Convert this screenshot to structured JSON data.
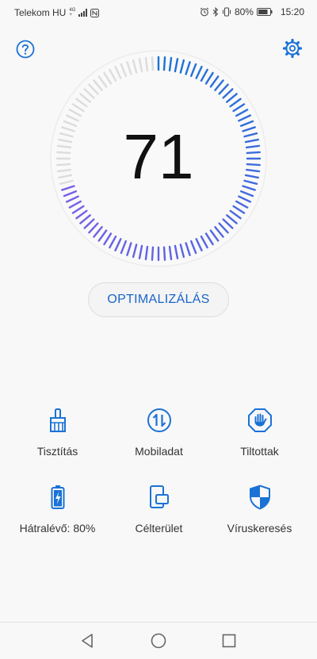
{
  "status_bar": {
    "carrier": "Telekom HU",
    "network_top": "4G",
    "network_bottom": "+",
    "battery_percent": "80%",
    "time": "15:20"
  },
  "header": {
    "help_icon": "help-icon",
    "settings_icon": "gear-icon"
  },
  "gauge": {
    "score": "71",
    "level": 0.71,
    "accent_color": "#1b72d6",
    "low_color": "#7b5ee8",
    "track_color": "#dcdcdc"
  },
  "optimize_button": {
    "label": "OPTIMALIZÁLÁS"
  },
  "tiles": [
    {
      "label": "Tisztítás",
      "icon": "broom-icon"
    },
    {
      "label": "Mobiladat",
      "icon": "data-arrows-icon"
    },
    {
      "label": "Tiltottak",
      "icon": "blocked-hand-icon"
    },
    {
      "label": "Hátralévő: 80%",
      "icon": "battery-icon"
    },
    {
      "label": "Célterület",
      "icon": "devices-icon"
    },
    {
      "label": "Víruskeresés",
      "icon": "shield-icon"
    }
  ],
  "nav_bar": {
    "back": "back-icon",
    "home": "home-icon",
    "recents": "recents-icon"
  }
}
